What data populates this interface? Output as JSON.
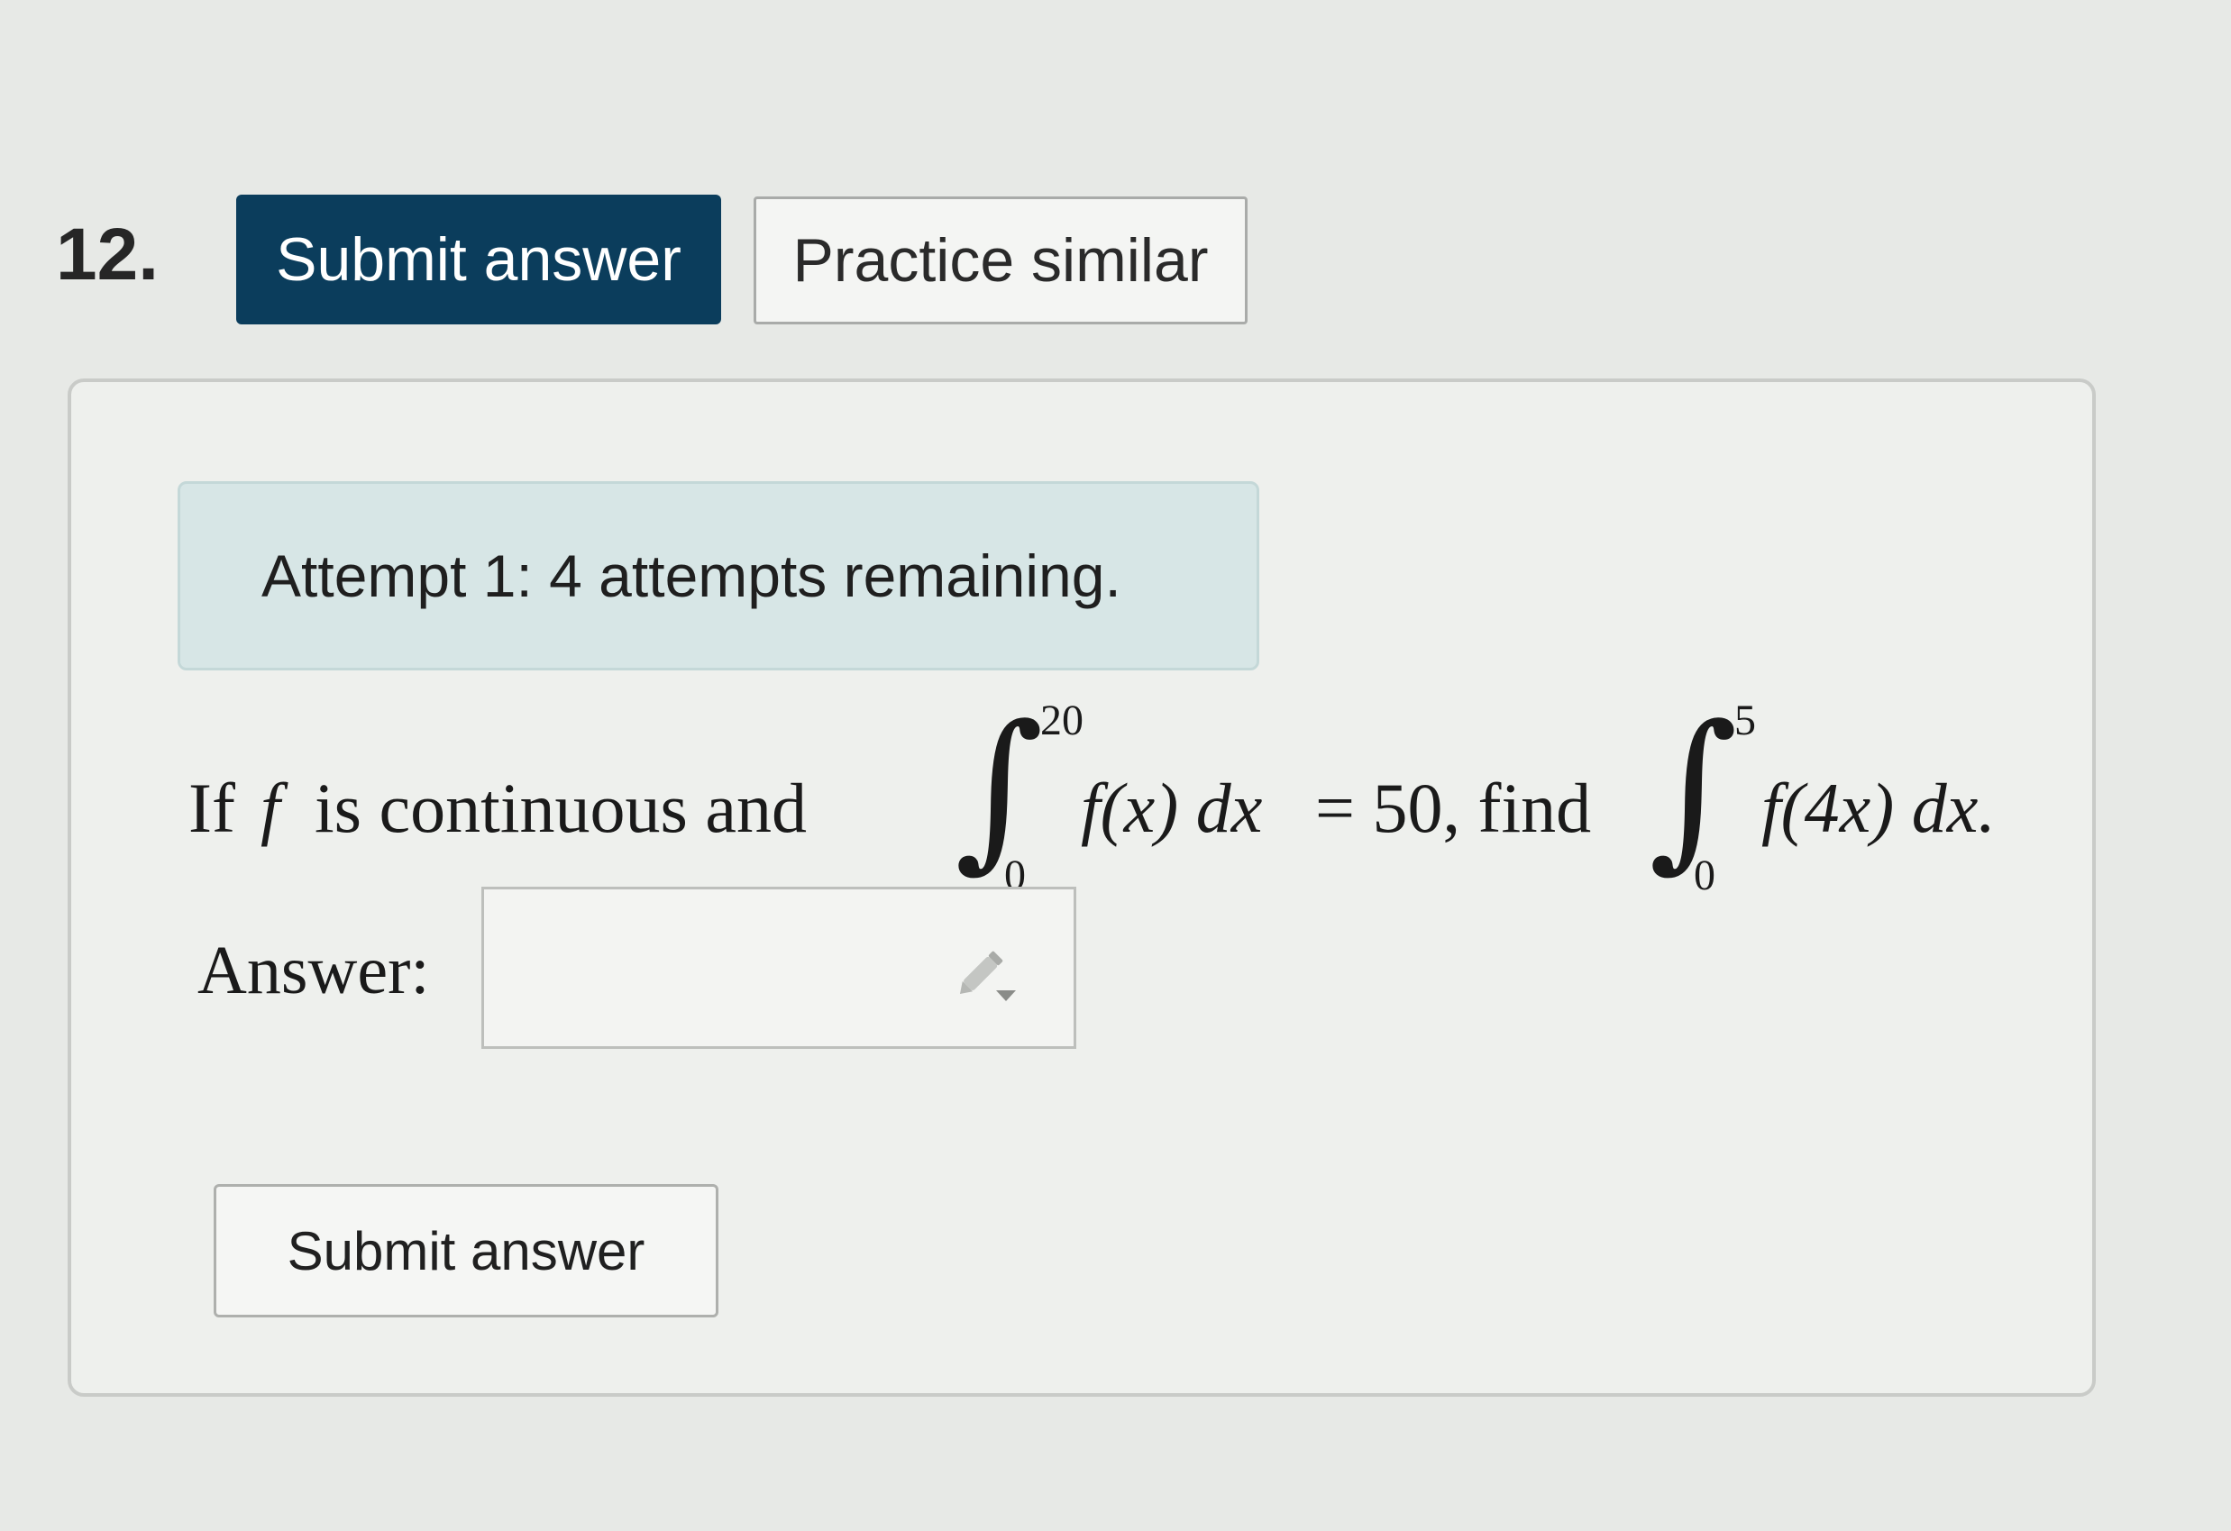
{
  "question": {
    "number": "12."
  },
  "toolbar": {
    "submit_label": "Submit answer",
    "practice_label": "Practice similar"
  },
  "attempts": {
    "notice": "Attempt 1: 4 attempts remaining."
  },
  "problem": {
    "lead": "If",
    "fn_symbol": "f",
    "mid": "is continuous and",
    "int1_upper": "20",
    "int1_lower": "0",
    "int1_integrand": "f(x) dx",
    "equals_part": "= 50, find",
    "int2_upper": "5",
    "int2_lower": "0",
    "int2_integrand": "f(4x) dx."
  },
  "answer": {
    "label": "Answer:",
    "value": ""
  },
  "footer": {
    "submit_label": "Submit answer"
  },
  "icons": {
    "pencil": "pencil-dropdown-icon"
  },
  "colors": {
    "primary_button": "#0b3d5c",
    "notice_bg": "#d7e6e6"
  }
}
